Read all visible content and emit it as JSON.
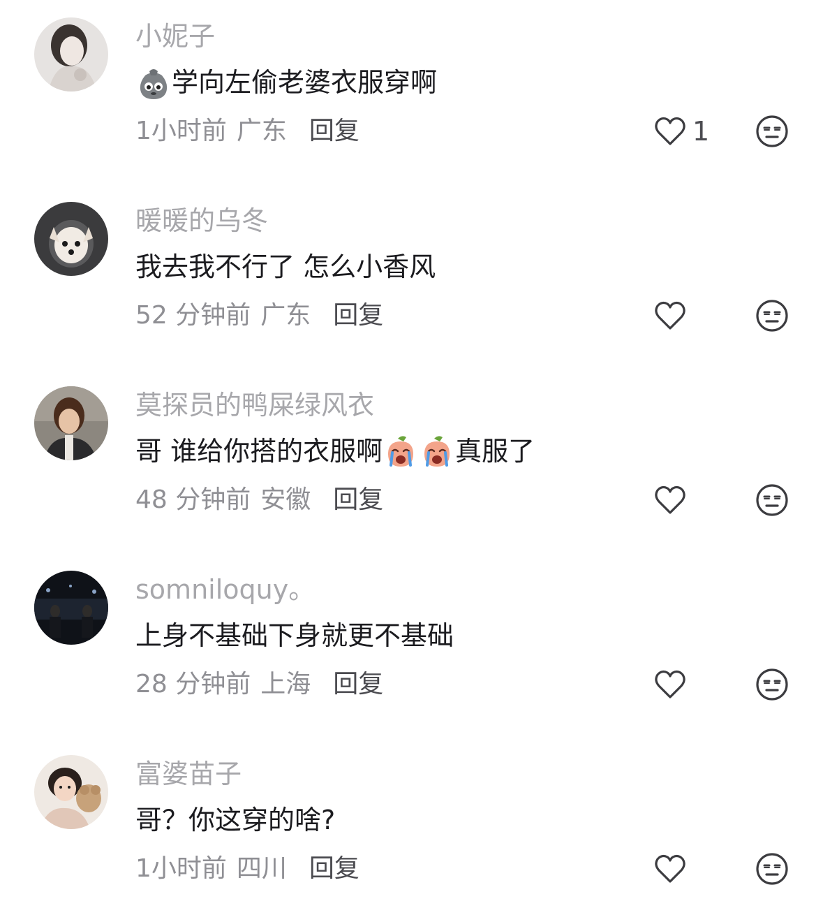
{
  "comments": [
    {
      "username": "小妮子",
      "body_text": "学向左偷老婆衣服穿啊",
      "body_emoji_lead": "sack-face-emoji",
      "time": "1小时前",
      "location": "广东",
      "reply_label": "回复",
      "like_count": "1"
    },
    {
      "username": "暖暖的乌冬",
      "body_text": "我去我不行了 怎么小香风",
      "time": "52 分钟前",
      "location": "广东",
      "reply_label": "回复"
    },
    {
      "username": "莫探员的鸭屎绿风衣",
      "body_text": "哥 谁给你搭的衣服啊",
      "body_emoji_tail": "crying-peach-emoji",
      "body_text_tail": "真服了",
      "time": "48 分钟前",
      "location": "安徽",
      "reply_label": "回复"
    },
    {
      "username": "somniloquy。",
      "body_text": "上身不基础下身就更不基础",
      "time": "28 分钟前",
      "location": "上海",
      "reply_label": "回复"
    },
    {
      "username": "富婆苗子",
      "body_text": "哥？你这穿的啥?",
      "time": "1小时前",
      "location": "四川",
      "reply_label": "回复"
    }
  ],
  "icons": {
    "like": "heart-outline-icon",
    "dislike": "unamused-face-icon"
  },
  "colors": {
    "username": "#a7a7ab",
    "body": "#1b1b1f",
    "meta": "#8f8f94",
    "reply": "#4b4b50",
    "icon": "#3c3c40"
  }
}
